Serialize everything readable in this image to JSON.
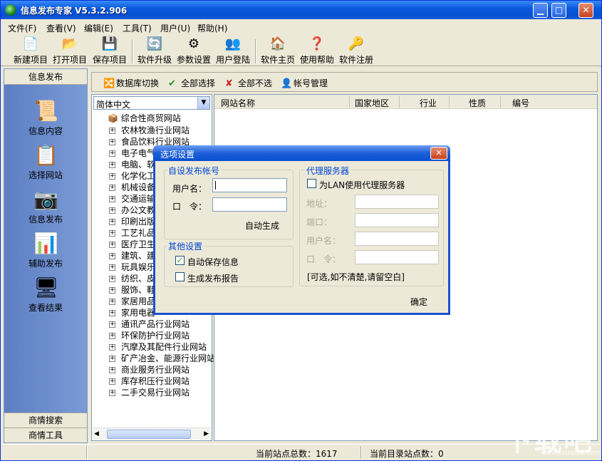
{
  "window": {
    "title": "信息发布专家 V5.3.2.906",
    "buttons": {
      "minimize": "▁",
      "maximize": "□",
      "close": "✕"
    }
  },
  "menu": [
    "文件(F)",
    "查看(V)",
    "编辑(E)",
    "工具(T)",
    "用户(U)",
    "帮助(H)"
  ],
  "toolbar": [
    {
      "label": "新建项目",
      "icon": "new-file-icon",
      "glyph": "📄"
    },
    {
      "label": "打开项目",
      "icon": "open-folder-icon",
      "glyph": "📂"
    },
    {
      "label": "保存项目",
      "icon": "save-disk-icon",
      "glyph": "💾"
    },
    {
      "label": "软件升级",
      "icon": "upgrade-icon",
      "glyph": "🔄"
    },
    {
      "label": "参数设置",
      "icon": "settings-icon",
      "glyph": "⚙"
    },
    {
      "label": "用户登陆",
      "icon": "user-login-icon",
      "glyph": "👥"
    },
    {
      "label": "软件主页",
      "icon": "home-icon",
      "glyph": "🏠"
    },
    {
      "label": "使用帮助",
      "icon": "help-icon",
      "glyph": "❓"
    },
    {
      "label": "软件注册",
      "icon": "register-icon",
      "glyph": "🔑"
    }
  ],
  "leftnav": {
    "header": "信息发布",
    "items": [
      {
        "label": "信息内容",
        "icon": "scroll-icon",
        "glyph": "📜"
      },
      {
        "label": "选择网站",
        "icon": "checklist-icon",
        "glyph": "📋"
      },
      {
        "label": "信息发布",
        "icon": "camera-icon",
        "glyph": "📷"
      },
      {
        "label": "辅助发布",
        "icon": "chart-icon",
        "glyph": "📊"
      },
      {
        "label": "查看结果",
        "icon": "computer-icon",
        "glyph": "🖥"
      }
    ],
    "footer1": "商情搜索",
    "footer2": "商情工具"
  },
  "actions": [
    {
      "label": "数据库切换",
      "icon": "database-switch-icon",
      "glyph": "🔀"
    },
    {
      "label": "全部选择",
      "icon": "check-all-icon",
      "glyph": "✔"
    },
    {
      "label": "全部不选",
      "icon": "uncheck-all-icon",
      "glyph": "✘"
    },
    {
      "label": "帐号管理",
      "icon": "account-icon",
      "glyph": "👤"
    }
  ],
  "tree": {
    "language": "简体中文",
    "root": "综合性商贸网站",
    "items": [
      "农林牧渔行业网站",
      "食品饮料行业网站",
      "电子电气",
      "电脑、软",
      "化学化工",
      "机械设备",
      "交通运输",
      "办公文教",
      "印刷出版",
      "工艺礼品",
      "医疗卫生",
      "建筑、建",
      "玩具娱乐",
      "纺织、皮",
      "服饰、鞋",
      "家居用品",
      "家用电器",
      "通讯产品行业网站",
      "环保防护行业网站",
      "汽摩及其配件行业网站",
      "矿产冶金、能源行业网站",
      "商业服务行业网站",
      "库存积压行业网站",
      "二手交易行业网站"
    ]
  },
  "list": {
    "columns": [
      "网站名称",
      "国家地区",
      "行业",
      "性质",
      "编号"
    ]
  },
  "status": {
    "total": "当前站点总数：1617",
    "dir": "当前目录站点数：0"
  },
  "dialog": {
    "title": "选项设置",
    "account_group": "自设发布帐号",
    "username_label": "用户名：",
    "password_label": "口　令：",
    "username_value": "",
    "password_value": "",
    "auto_generate": "自动生成",
    "other_group": "其他设置",
    "auto_save": "自动保存信息",
    "gen_report": "生成发布报告",
    "proxy_group": "代理服务器",
    "use_proxy": "为LAN使用代理服务器",
    "proxy_address": "地址：",
    "proxy_port": "端口：",
    "proxy_user": "用户名：",
    "proxy_pass": "口　令：",
    "proxy_note": "[可选,如不清楚,请留空白]",
    "ok": "确定"
  },
  "watermark": {
    "text": "下载吧",
    "sub": "www.xiazaiba.com"
  }
}
